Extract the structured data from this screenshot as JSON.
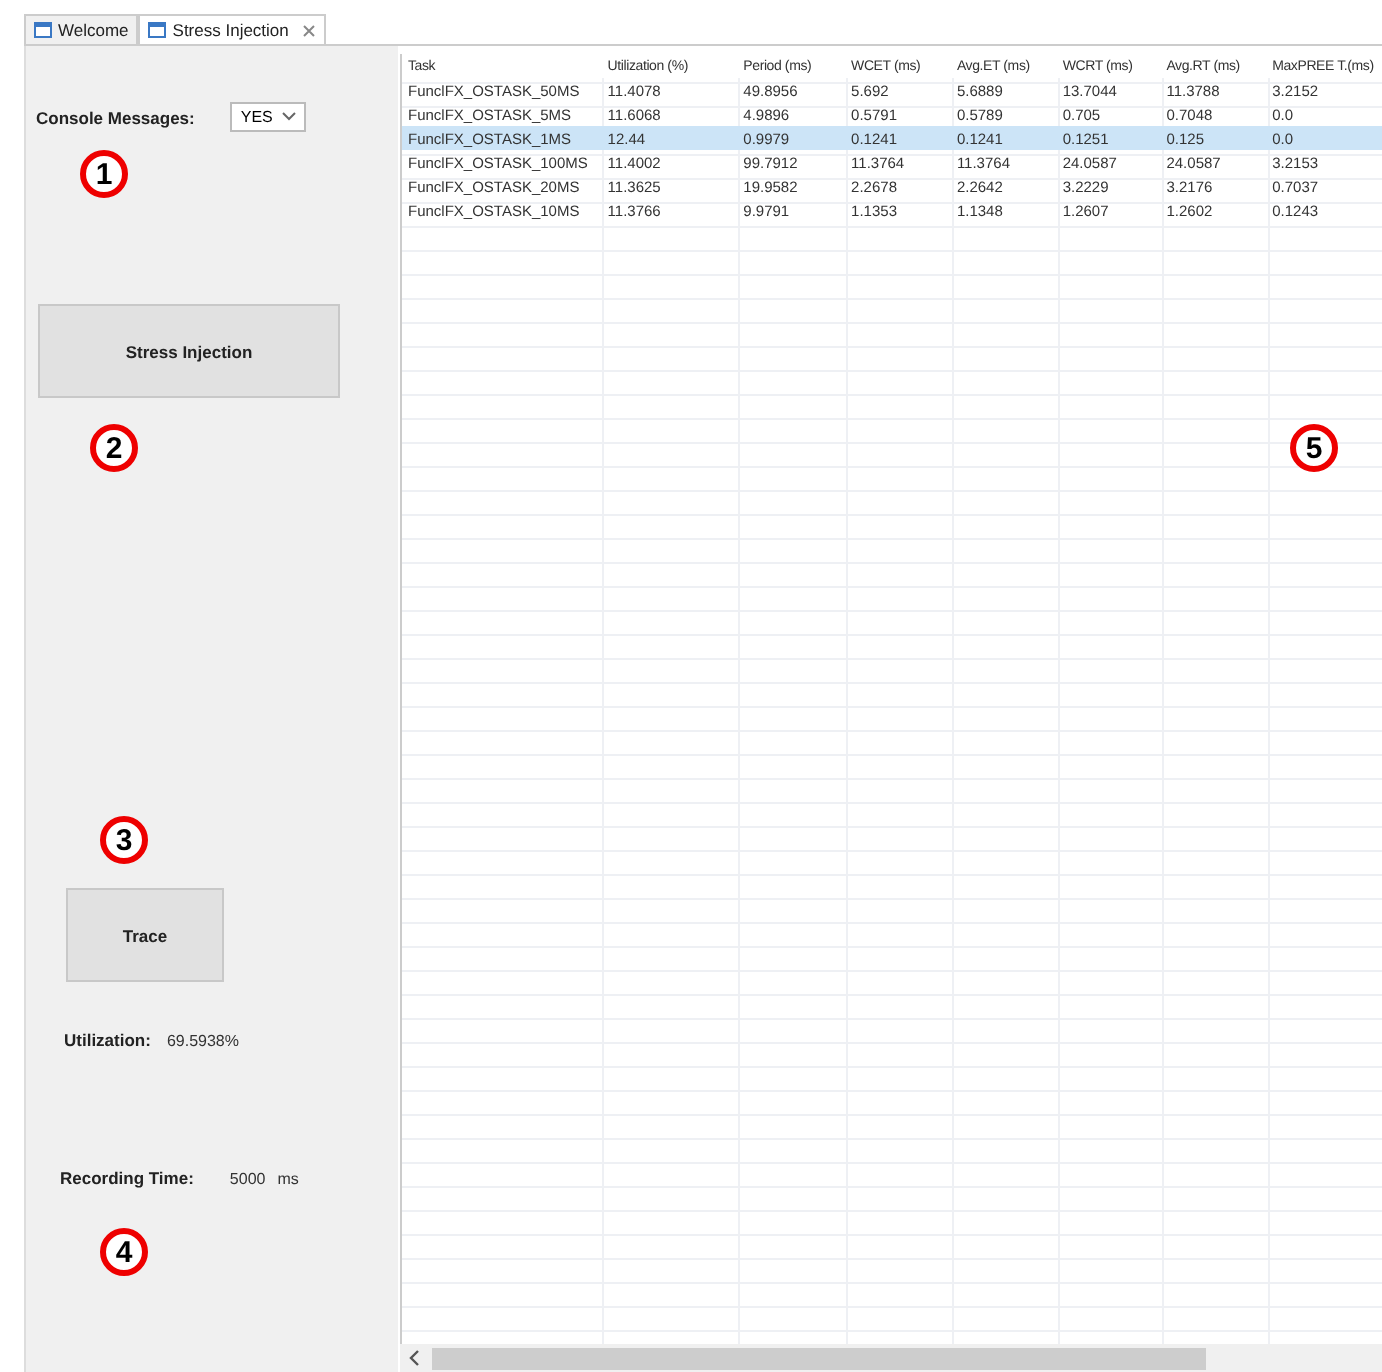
{
  "tabs": [
    {
      "label": "Welcome",
      "selected": false,
      "closable": false
    },
    {
      "label": "Stress Injection",
      "selected": true,
      "closable": true
    }
  ],
  "console_messages": {
    "label": "Console Messages:",
    "value": "YES"
  },
  "stress_button": "Stress Injection",
  "trace_button": "Trace",
  "utilization": {
    "label": "Utilization:",
    "value": "69.5938%"
  },
  "recording_time": {
    "label": "Recording Time:",
    "value": "5000",
    "unit": "ms"
  },
  "markers": [
    "1",
    "2",
    "3",
    "4",
    "5"
  ],
  "table": {
    "columns": [
      "Task",
      "Utilization (%)",
      "Period (ms)",
      "WCET (ms)",
      "Avg.ET (ms)",
      "WCRT (ms)",
      "Avg.RT (ms)",
      "MaxPREE T.(ms)"
    ],
    "rows": [
      {
        "cells": [
          "FunclFX_OSTASK_50MS",
          "11.4078",
          "49.8956",
          "5.692",
          "5.6889",
          "13.7044",
          "11.3788",
          "3.2152"
        ],
        "selected": false
      },
      {
        "cells": [
          "FunclFX_OSTASK_5MS",
          "11.6068",
          "4.9896",
          "0.5791",
          "0.5789",
          "0.705",
          "0.7048",
          "0.0"
        ],
        "selected": false
      },
      {
        "cells": [
          "FunclFX_OSTASK_1MS",
          "12.44",
          "0.9979",
          "0.1241",
          "0.1241",
          "0.1251",
          "0.125",
          "0.0"
        ],
        "selected": true
      },
      {
        "cells": [
          "FunclFX_OSTASK_100MS",
          "11.4002",
          "99.7912",
          "11.3764",
          "11.3764",
          "24.0587",
          "24.0587",
          "3.2153"
        ],
        "selected": false
      },
      {
        "cells": [
          "FunclFX_OSTASK_20MS",
          "11.3625",
          "19.9582",
          "2.2678",
          "2.2642",
          "3.2229",
          "3.2176",
          "0.7037"
        ],
        "selected": false
      },
      {
        "cells": [
          "FunclFX_OSTASK_10MS",
          "11.3766",
          "9.9791",
          "1.1353",
          "1.1348",
          "1.2607",
          "1.2602",
          "0.1243"
        ],
        "selected": false
      }
    ]
  }
}
